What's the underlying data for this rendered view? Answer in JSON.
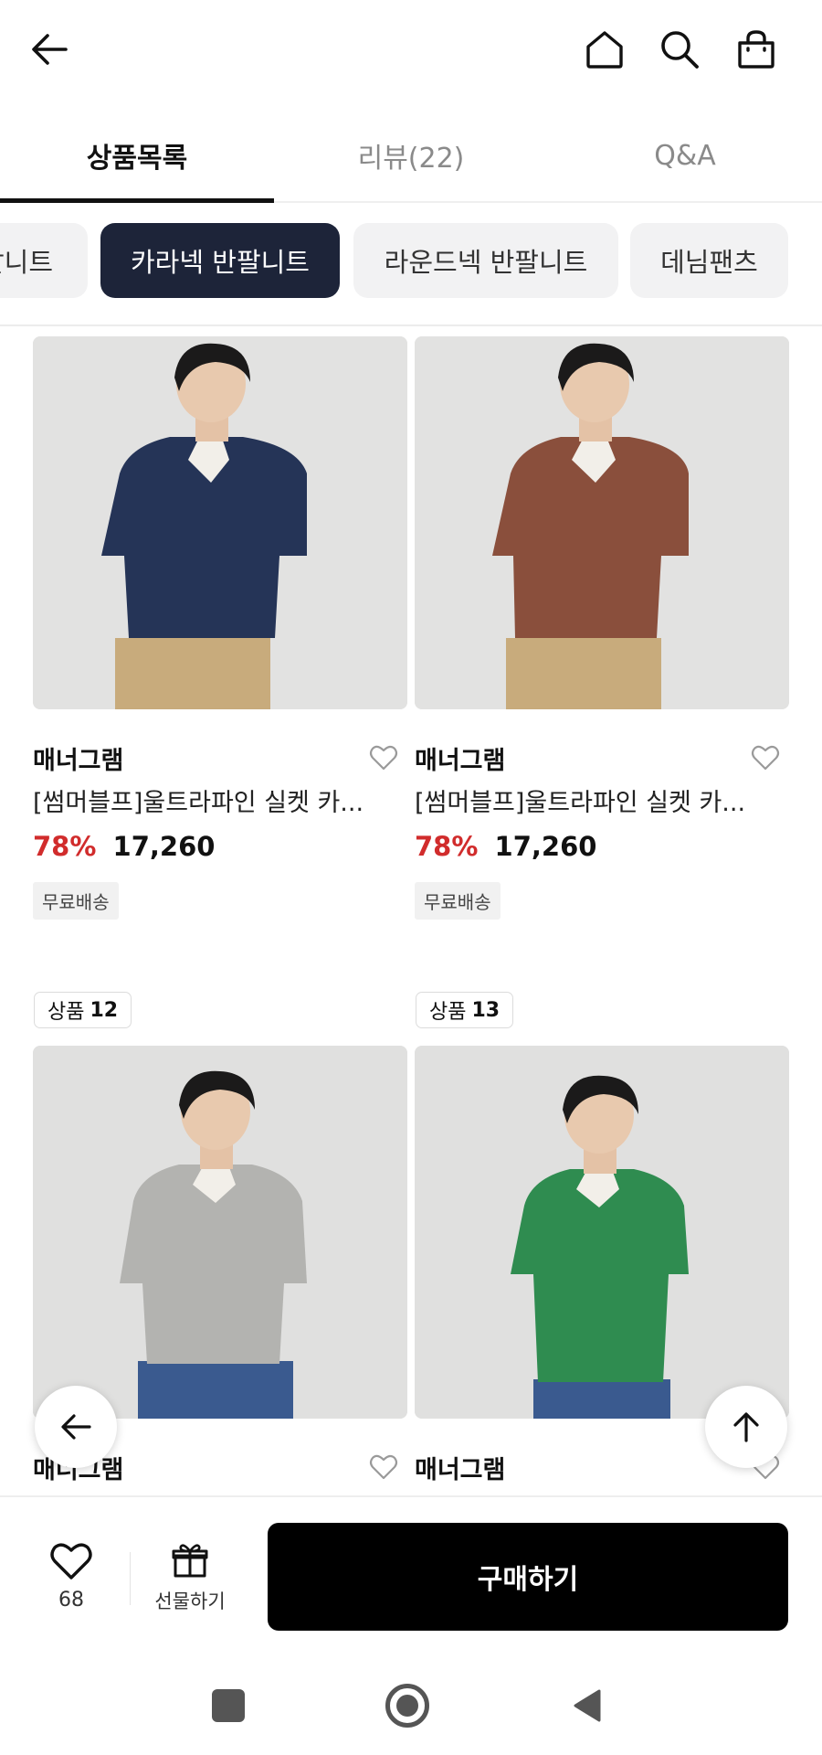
{
  "header": {
    "icons": [
      "back-arrow-icon",
      "home-icon",
      "search-icon",
      "shopping-bag-icon"
    ]
  },
  "tabs": [
    {
      "label": "상품목록",
      "active": true
    },
    {
      "label": "리뷰(22)",
      "active": false
    },
    {
      "label": "Q&A",
      "active": false
    }
  ],
  "chips": [
    {
      "label": "팔니트",
      "active": false
    },
    {
      "label": "카라넥 반팔니트",
      "active": true
    },
    {
      "label": "라운드넥 반팔니트",
      "active": false
    },
    {
      "label": "데님팬츠",
      "active": false
    }
  ],
  "products": [
    {
      "brand": "매너그램",
      "name": "[썸머블프]울트라파인 실켓 카...",
      "discount": "78%",
      "price": "17,260",
      "badge": "무료배송",
      "color": "#253457"
    },
    {
      "brand": "매너그램",
      "name": "[썸머블프]울트라파인 실켓 카...",
      "discount": "78%",
      "price": "17,260",
      "badge": "무료배송",
      "color": "#8a4f3c"
    },
    {
      "brand": "매너그램",
      "color": "#b3b3b0"
    },
    {
      "brand": "매너그램",
      "color": "#2f8c50"
    }
  ],
  "labels": [
    {
      "prefix": "상품",
      "number": "12"
    },
    {
      "prefix": "상품",
      "number": "13"
    }
  ],
  "bottom_bar": {
    "like_count": "68",
    "gift_label": "선물하기",
    "buy_label": "구매하기"
  },
  "colors": {
    "accent_chip": "#1d2439",
    "discount": "#d12c2c",
    "buy_button": "#000000"
  }
}
